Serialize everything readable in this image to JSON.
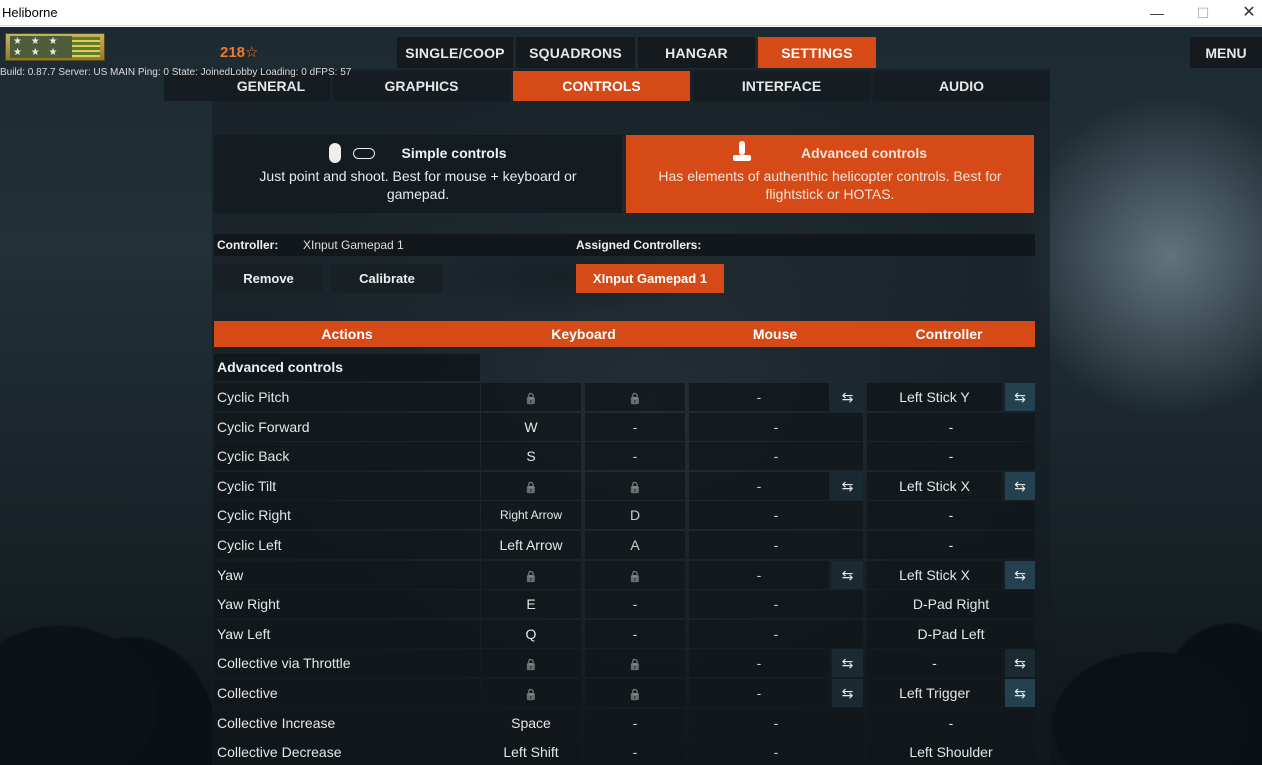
{
  "window": {
    "title": "Heliborne",
    "minimize": "—",
    "maximize": "☐",
    "close": "✕"
  },
  "player": {
    "points": "218",
    "star_icon": "star-outline-icon"
  },
  "build_info": "Build: 0.87.7 Server: US MAIN Ping: 0 State: JoinedLobby Loading: 0 dFPS: 57",
  "top_nav": [
    {
      "label": "SINGLE/COOP",
      "active": false
    },
    {
      "label": "SQUADRONS",
      "active": false
    },
    {
      "label": "HANGAR",
      "active": false
    },
    {
      "label": "SETTINGS",
      "active": true
    }
  ],
  "menu_label": "MENU",
  "sub_nav": [
    {
      "label": "GENERAL",
      "active": false
    },
    {
      "label": "GRAPHICS",
      "active": false
    },
    {
      "label": "CONTROLS",
      "active": true
    },
    {
      "label": "INTERFACE",
      "active": false
    },
    {
      "label": "AUDIO",
      "active": false
    }
  ],
  "modes": {
    "simple": {
      "title": "Simple controls",
      "desc": "Just point and shoot. Best for mouse + keyboard or gamepad."
    },
    "advanced": {
      "title": "Advanced controls",
      "desc": "Has elements of authenthic helicopter controls. Best for flightstick or HOTAS."
    }
  },
  "controller": {
    "label": "Controller:",
    "value": "XInput Gamepad 1",
    "assigned_label": "Assigned Controllers:",
    "remove": "Remove",
    "calibrate": "Calibrate",
    "assigned": "XInput Gamepad 1"
  },
  "table": {
    "headers": {
      "actions": "Actions",
      "keyboard": "Keyboard",
      "mouse": "Mouse",
      "controller": "Controller"
    },
    "section": "Advanced controls",
    "rows": [
      {
        "name": "Cyclic Pitch",
        "k1": "",
        "k2": "",
        "mouse": "-",
        "ctrl": "Left Stick Y",
        "axis": true,
        "ctrl_swap": true
      },
      {
        "name": "Cyclic Forward",
        "k1": "W",
        "k2": "-",
        "mouse": "-",
        "ctrl": "-",
        "axis": false
      },
      {
        "name": "Cyclic Back",
        "k1": "S",
        "k2": "-",
        "mouse": "-",
        "ctrl": "-",
        "axis": false
      },
      {
        "name": "Cyclic Tilt",
        "k1": "",
        "k2": "",
        "mouse": "-",
        "ctrl": "Left Stick X",
        "axis": true,
        "ctrl_swap": true
      },
      {
        "name": "Cyclic Right",
        "k1": "Right Arrow",
        "k2": "D",
        "mouse": "-",
        "ctrl": "-",
        "axis": false,
        "k1_small": true
      },
      {
        "name": "Cyclic Left",
        "k1": "Left Arrow",
        "k2": "A",
        "mouse": "-",
        "ctrl": "-",
        "axis": false
      },
      {
        "name": "Yaw",
        "k1": "",
        "k2": "",
        "mouse": "-",
        "ctrl": "Left Stick X",
        "axis": true,
        "ctrl_swap": true
      },
      {
        "name": "Yaw Right",
        "k1": "E",
        "k2": "-",
        "mouse": "-",
        "ctrl": "D-Pad Right",
        "axis": false
      },
      {
        "name": "Yaw Left",
        "k1": "Q",
        "k2": "-",
        "mouse": "-",
        "ctrl": "D-Pad Left",
        "axis": false
      },
      {
        "name": "Collective via Throttle",
        "k1": "",
        "k2": "",
        "mouse": "-",
        "ctrl": "-",
        "axis": true,
        "ctrl_swap": true,
        "ctrl_swap_plain": true
      },
      {
        "name": "Collective",
        "k1": "",
        "k2": "",
        "mouse": "-",
        "ctrl": "Left Trigger",
        "axis": true,
        "ctrl_swap": true
      },
      {
        "name": "Collective Increase",
        "k1": "Space",
        "k2": "-",
        "mouse": "-",
        "ctrl": "-",
        "axis": false
      },
      {
        "name": "Collective Decrease",
        "k1": "Left Shift",
        "k2": "-",
        "mouse": "-",
        "ctrl": "Left Shoulder",
        "axis": false
      }
    ]
  },
  "icons": {
    "lock": "lock-icon",
    "swap": "swap-arrows-icon",
    "mouse": "mouse-icon",
    "gamepad": "gamepad-icon",
    "joystick": "joystick-icon"
  },
  "colors": {
    "accent": "#d54a16",
    "panel": "#151c21"
  }
}
